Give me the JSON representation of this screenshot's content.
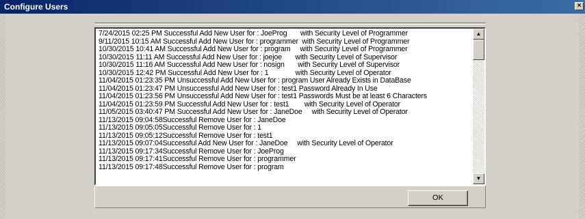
{
  "window": {
    "title": "Configure Users",
    "close_glyph": "×"
  },
  "log": {
    "lines": [
      "7/24/2015 02:25 PM Successful Add New User for : JoeProg       with Security Level of Programmer",
      "9/11/2015 10:15 AM Successful Add New User for : programmer  with Security Level of Programmer",
      "10/30/2015 10:41 AM Successful Add New User for : program     with Security Level of Programmer",
      "10/30/2015 11:11 AM Successful Add New User for : joejoe       with Security Level of Supervisor",
      "10/30/2015 11:16 AM Successful Add New User for : nosign       with Security Level of Supervisor",
      "10/30/2015 12:42 PM Successful Add New User for : 1              with Security Level of Operator",
      "11/04/2015 01:23:35 PM Unsuccessful Add New User for : program User Already Exists in DataBase",
      "11/04/2015 01:23:47 PM Unsuccessful Add New User for : test1 Password Already In Use",
      "11/04/2015 01:23:56 PM Unsuccessful Add New User for : test1 Passwords Must be at least 6 Characters",
      "11/04/2015 01:23:59 PM Successful Add New User for : test1        with Security Level of Operator",
      "11/05/2015 03:40:47 PM Successful Add New User for : JaneDoe     with Security Level of Operator",
      "11/13/2015 09:04:58Successful Remove User for : JaneDoe",
      "11/13/2015 09:05:05Successful Remove User for : 1",
      "11/13/2015 09:05:12Successful Remove User for : test1",
      "11/13/2015 09:07:04Successful Add New User for : JaneDoe     with Security Level of Operator",
      "11/13/2015 09:17:34Successful Remove User for : JoeProg",
      "11/13/2015 09:17:41Successful Remove User for : programmer",
      "11/13/2015 09:17:48Successful Remove User for : program"
    ]
  },
  "scrollbar": {
    "up_glyph": "▲",
    "down_glyph": "▼"
  },
  "buttons": {
    "ok_label": "OK"
  }
}
